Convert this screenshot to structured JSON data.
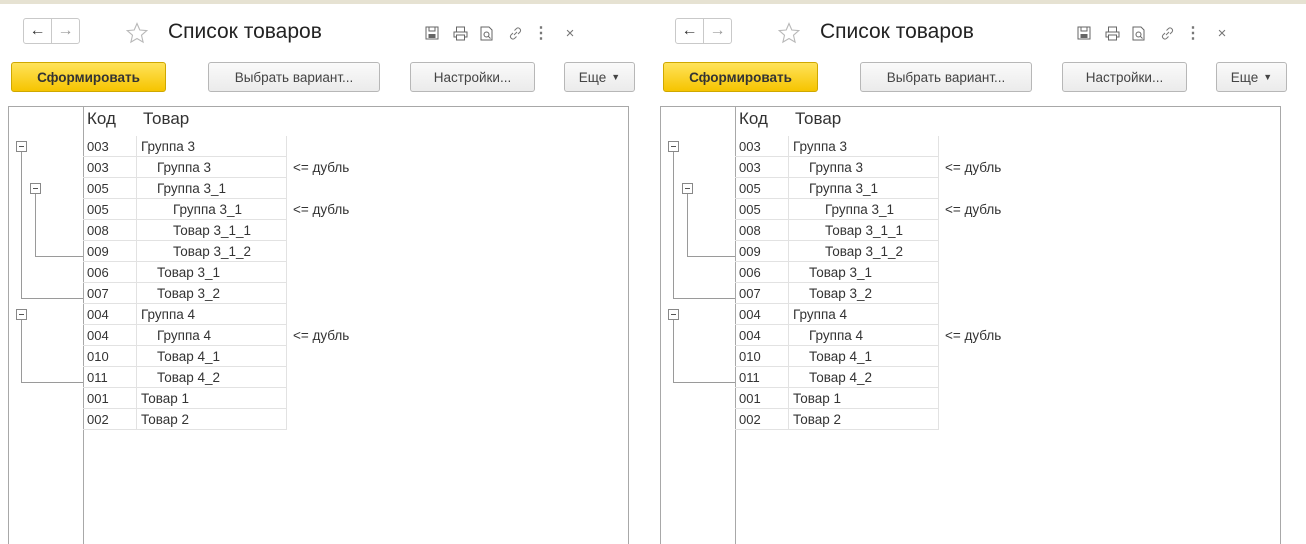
{
  "panels": [
    {
      "title": "Список товаров",
      "buttons": {
        "generate": "Сформировать",
        "choose_variant": "Выбрать вариант...",
        "settings": "Настройки...",
        "more": "Еще"
      },
      "table": {
        "headers": {
          "code": "Код",
          "item": "Товар"
        },
        "rows": [
          {
            "code": "003",
            "item": "Группа 3",
            "level": 0,
            "note": ""
          },
          {
            "code": "003",
            "item": "Группа 3",
            "level": 1,
            "note": "<= дубль"
          },
          {
            "code": "005",
            "item": "Группа 3_1",
            "level": 1,
            "note": ""
          },
          {
            "code": "005",
            "item": "Группа 3_1",
            "level": 2,
            "note": "<= дубль"
          },
          {
            "code": "008",
            "item": "Товар 3_1_1",
            "level": 2,
            "note": ""
          },
          {
            "code": "009",
            "item": "Товар 3_1_2",
            "level": 2,
            "note": ""
          },
          {
            "code": "006",
            "item": "Товар 3_1",
            "level": 1,
            "note": ""
          },
          {
            "code": "007",
            "item": "Товар 3_2",
            "level": 1,
            "note": ""
          },
          {
            "code": "004",
            "item": "Группа 4",
            "level": 0,
            "note": ""
          },
          {
            "code": "004",
            "item": "Группа 4",
            "level": 1,
            "note": "<= дубль"
          },
          {
            "code": "010",
            "item": "Товар 4_1",
            "level": 1,
            "note": ""
          },
          {
            "code": "011",
            "item": "Товар 4_2",
            "level": 1,
            "note": ""
          },
          {
            "code": "001",
            "item": "Товар 1",
            "level": 0,
            "note": ""
          },
          {
            "code": "002",
            "item": "Товар 2",
            "level": 0,
            "note": ""
          }
        ]
      }
    },
    {
      "title": "Список товаров",
      "buttons": {
        "generate": "Сформировать",
        "choose_variant": "Выбрать вариант...",
        "settings": "Настройки...",
        "more": "Еще"
      },
      "table": {
        "headers": {
          "code": "Код",
          "item": "Товар"
        },
        "rows": [
          {
            "code": "003",
            "item": "Группа 3",
            "level": 0,
            "note": ""
          },
          {
            "code": "003",
            "item": "Группа 3",
            "level": 1,
            "note": "<= дубль"
          },
          {
            "code": "005",
            "item": "Группа 3_1",
            "level": 1,
            "note": ""
          },
          {
            "code": "005",
            "item": "Группа 3_1",
            "level": 2,
            "note": "<= дубль"
          },
          {
            "code": "008",
            "item": "Товар 3_1_1",
            "level": 2,
            "note": ""
          },
          {
            "code": "009",
            "item": "Товар 3_1_2",
            "level": 2,
            "note": ""
          },
          {
            "code": "006",
            "item": "Товар 3_1",
            "level": 1,
            "note": ""
          },
          {
            "code": "007",
            "item": "Товар 3_2",
            "level": 1,
            "note": ""
          },
          {
            "code": "004",
            "item": "Группа 4",
            "level": 0,
            "note": ""
          },
          {
            "code": "004",
            "item": "Группа 4",
            "level": 1,
            "note": "<= дубль"
          },
          {
            "code": "010",
            "item": "Товар 4_1",
            "level": 1,
            "note": ""
          },
          {
            "code": "011",
            "item": "Товар 4_2",
            "level": 1,
            "note": ""
          },
          {
            "code": "001",
            "item": "Товар 1",
            "level": 0,
            "note": ""
          },
          {
            "code": "002",
            "item": "Товар 2",
            "level": 0,
            "note": ""
          }
        ]
      }
    }
  ],
  "icons": {
    "back": "arrow-left-icon",
    "forward": "arrow-right-icon",
    "favorite": "star-icon",
    "save": "save-icon",
    "print": "print-icon",
    "preview": "preview-icon",
    "link": "link-icon",
    "more": "more-vertical-icon",
    "close": "close-icon",
    "dropdown": "chevron-down-icon"
  },
  "colors": {
    "primary_button": "#f6c400",
    "frame": "#a8a8a8"
  }
}
